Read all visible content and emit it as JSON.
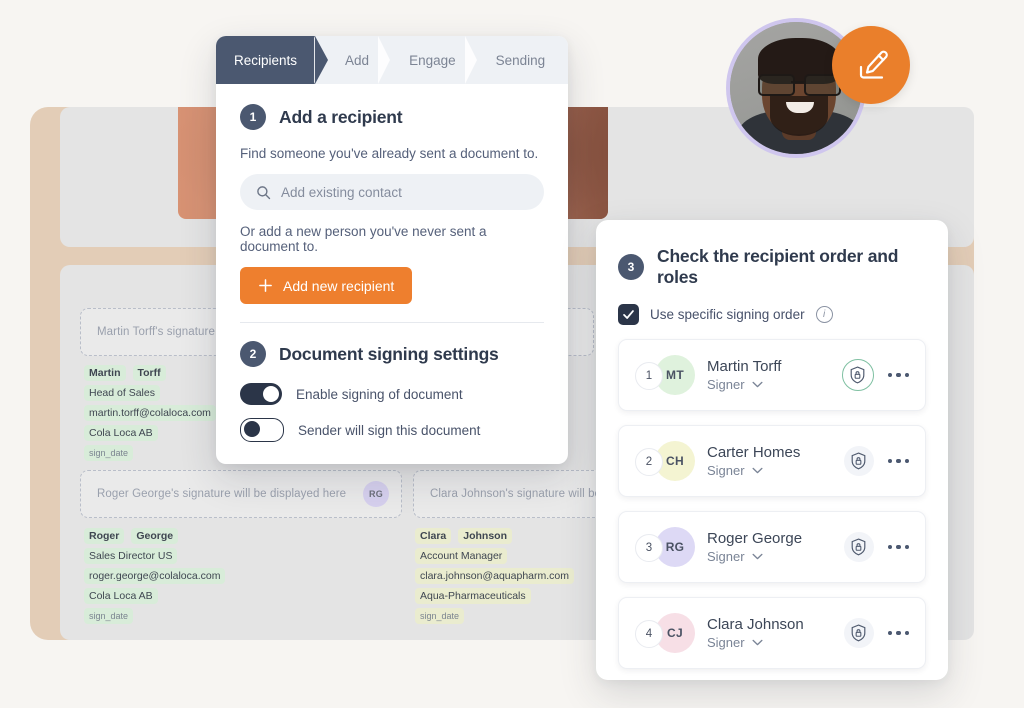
{
  "wizard": {
    "steps": [
      {
        "label": "Recipients",
        "state": "active"
      },
      {
        "label": "Add",
        "state": "inactive"
      },
      {
        "label": "Engage",
        "state": "inactive"
      },
      {
        "label": "Sending",
        "state": "inactive"
      }
    ]
  },
  "step1": {
    "number": "1",
    "title": "Add a recipient",
    "helper_existing": "Find someone you've already sent a document to.",
    "search_placeholder": "Add existing contact",
    "search_icon": "search-icon",
    "helper_new": "Or add a new person you've never sent a document to.",
    "add_button_label": "Add new recipient",
    "add_button_icon": "plus-icon",
    "add_button_color": "#ee7f2e"
  },
  "step2": {
    "number": "2",
    "title": "Document signing settings",
    "toggles": [
      {
        "label": "Enable signing of document",
        "state": "on"
      },
      {
        "label": "Sender will sign this document",
        "state": "off"
      }
    ]
  },
  "step3": {
    "number": "3",
    "title": "Check the recipient order and roles",
    "checkbox": {
      "label": "Use specific signing order",
      "checked": true,
      "info_icon": "info-icon"
    },
    "recipients": [
      {
        "order": "1",
        "initials": "MT",
        "name": "Martin Torff",
        "role": "Signer",
        "avatar_color": "#dff2dd",
        "shield_state": "highlighted",
        "shield_icon": "shield-lock-icon",
        "menu_icon": "more-options-icon",
        "chevron_icon": "chevron-down-icon"
      },
      {
        "order": "2",
        "initials": "CH",
        "name": "Carter Homes",
        "role": "Signer",
        "avatar_color": "#f4f4d2",
        "shield_state": "plain",
        "shield_icon": "shield-lock-icon",
        "menu_icon": "more-options-icon",
        "chevron_icon": "chevron-down-icon"
      },
      {
        "order": "3",
        "initials": "RG",
        "name": "Roger George",
        "role": "Signer",
        "avatar_color": "#ddd9f5",
        "shield_state": "plain",
        "shield_icon": "shield-lock-icon",
        "menu_icon": "more-options-icon",
        "chevron_icon": "chevron-down-icon"
      },
      {
        "order": "4",
        "initials": "CJ",
        "name": "Clara Johnson",
        "role": "Signer",
        "avatar_color": "#f7dfe6",
        "shield_state": "plain",
        "shield_icon": "shield-lock-icon",
        "menu_icon": "more-options-icon",
        "chevron_icon": "chevron-down-icon"
      }
    ]
  },
  "document": {
    "signature_boxes": [
      {
        "placeholder": "Martin Torff's signature will be displayed here",
        "badge": ""
      },
      {
        "placeholder": "Roger George's signature will be displayed here",
        "badge": "RG"
      },
      {
        "placeholder": "Clara Johnson's signature will be displayed here",
        "badge": ""
      }
    ],
    "field_blocks": [
      {
        "tint": "green",
        "first_name": "Martin",
        "last_name": "Torff",
        "title": "Head of Sales",
        "email": "martin.torff@colaloca.com",
        "company": "Cola Loca AB",
        "date_field": "sign_date"
      },
      {
        "tint": "green",
        "first_name": "Roger",
        "last_name": "George",
        "title": "Sales Director US",
        "email": "roger.george@colaloca.com",
        "company": "Cola Loca AB",
        "date_field": "sign_date"
      },
      {
        "tint": "olive",
        "first_name": "Clara",
        "last_name": "Johnson",
        "title": "Account Manager",
        "email": "clara.johnson@aquapharm.com",
        "company": "Aqua-Pharmaceuticals",
        "date_field": "sign_date"
      }
    ]
  },
  "avatar": {
    "name": "user-photo-avatar",
    "ring_color": "#cfc6ee"
  },
  "pencil_badge": {
    "icon": "pencil-sign-icon",
    "color": "#ea7f2b"
  },
  "theme": {
    "page_bg": "#f7f5f2",
    "tan_card": "#e3cdb7",
    "doc_panel": "#e4e4e4",
    "accent_orange": "#ee7f2e",
    "navy": "#2b3548",
    "slate": "#4b5870"
  }
}
